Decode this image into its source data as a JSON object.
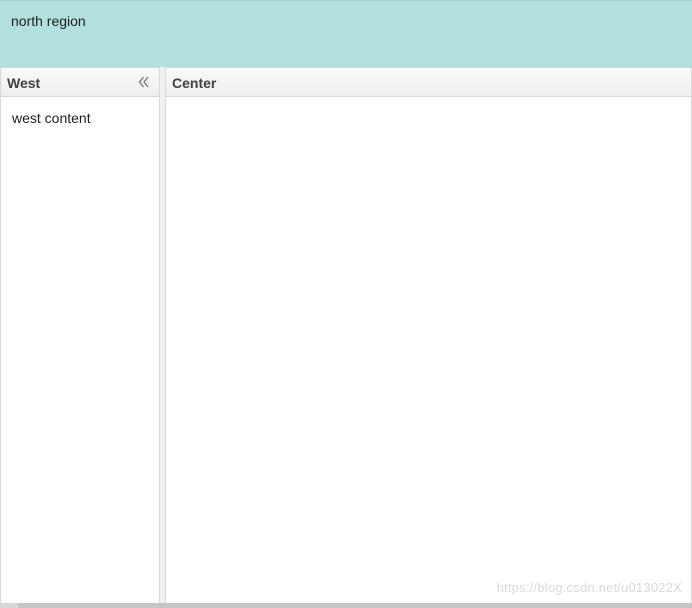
{
  "north": {
    "text": "north region"
  },
  "west": {
    "title": "West",
    "content": "west content",
    "collapse_icon": "double-chevron-left-icon"
  },
  "center": {
    "title": "Center"
  },
  "watermark": {
    "text": "https://blog.csdn.net/u013022X"
  },
  "colors": {
    "north_bg": "#b2e0dc",
    "header_text": "#404040"
  }
}
